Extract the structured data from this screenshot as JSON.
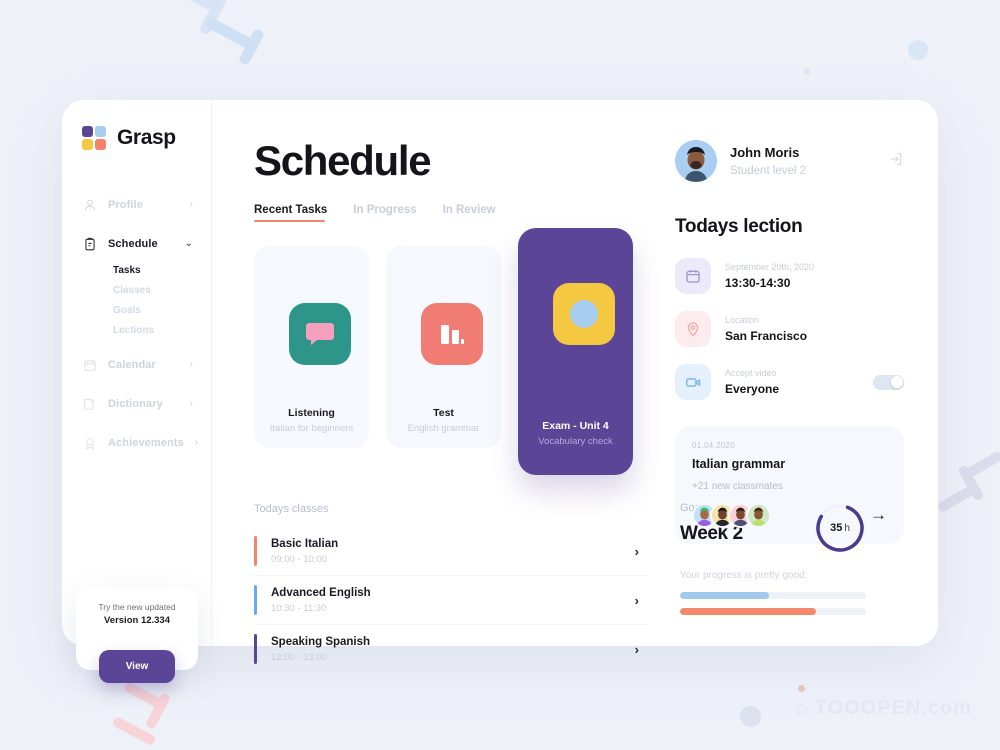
{
  "brand": {
    "name": "Grasp",
    "logo_icon": "puzzle-logo-icon",
    "colors": {
      "purple": "#5b4596",
      "blue": "#a7cdf0",
      "yellow": "#f5c842",
      "coral": "#f4836c"
    }
  },
  "sidebar": {
    "items": [
      {
        "label": "Profile",
        "icon": "person-icon",
        "chevron": "›",
        "active": false
      },
      {
        "label": "Schedule",
        "icon": "clipboard-icon",
        "chevron": "⌄",
        "active": true
      },
      {
        "label": "Calendar",
        "icon": "calendar-icon",
        "chevron": "›",
        "active": false
      },
      {
        "label": "Dictionary",
        "icon": "dictionary-icon",
        "chevron": "›",
        "active": false
      },
      {
        "label": "Achievements",
        "icon": "medal-icon",
        "chevron": "›",
        "active": false
      }
    ],
    "sub_items": [
      {
        "label": "Tasks",
        "active": true
      },
      {
        "label": "Classes",
        "active": false
      },
      {
        "label": "Goals",
        "active": false
      },
      {
        "label": "Lections",
        "active": false
      }
    ],
    "promo": {
      "line1": "Try the new updated",
      "line2": "Version 12.334",
      "button": "View"
    }
  },
  "header": {
    "title": "Schedule"
  },
  "tabs": [
    {
      "label": "Recent Tasks",
      "active": true
    },
    {
      "label": "In Progress",
      "active": false
    },
    {
      "label": "In Review",
      "active": false
    }
  ],
  "task_cards": [
    {
      "title": "Listening",
      "subtitle": "Italian for beginners",
      "icon": "chat-bubble-icon",
      "tile_color": "#2e9688",
      "accent_color": "#f6a0bd",
      "featured": false
    },
    {
      "title": "Test",
      "subtitle": "English grammar",
      "icon": "bar-chart-icon",
      "tile_color": "#f07c74",
      "accent_color": "#ffffff",
      "featured": false
    },
    {
      "title": "Exam - Unit 4",
      "subtitle": "Vocabulary check",
      "icon": "circle-shape-icon",
      "tile_color": "#f5c842",
      "accent_color": "#a7cdf0",
      "featured": true
    }
  ],
  "classes": {
    "label": "Todays classes",
    "items": [
      {
        "name": "Basic Italian",
        "time": "09:00 - 10:00",
        "color": "#f4836c",
        "arrow": "›"
      },
      {
        "name": "Advanced  English",
        "time": "10:30 - 11:30",
        "color": "#6aaceb",
        "arrow": "›"
      },
      {
        "name": "Speaking Spanish",
        "time": "12:00 - 13:00",
        "color": "#5b4596",
        "arrow": "›"
      }
    ]
  },
  "goals": {
    "label": "Goals",
    "week": "Week 2",
    "hours_value": "35",
    "hours_unit": "h",
    "note": "Your progress is pretty good:",
    "ring_percent": 78,
    "bars": [
      {
        "name": "blue-progress",
        "percent": 48,
        "color": "#a2c9ec"
      },
      {
        "name": "orange-progress",
        "percent": 73,
        "color": "#f4886a"
      }
    ]
  },
  "profile": {
    "name": "John Moris",
    "role": "Student level 2",
    "logout_icon": "logout-icon",
    "avatar_icon": "user-avatar"
  },
  "lection": {
    "title": "Todays lection",
    "rows": [
      {
        "label": "September 20th, 2020",
        "value": "13:30-14:30",
        "icon": "calendar-icon",
        "tile_bg": "#eceaf9",
        "icon_color": "#9a93d6",
        "toggle": null
      },
      {
        "label": "Location",
        "value": "San Francisco",
        "icon": "location-pin-icon",
        "tile_bg": "#fdeced",
        "icon_color": "#f3a8ac",
        "toggle": null
      },
      {
        "label": "Accept video",
        "value": "Everyone",
        "icon": "video-camera-icon",
        "tile_bg": "#e4f0fc",
        "icon_color": "#79b3e8",
        "toggle": "on"
      }
    ]
  },
  "upcoming": {
    "date": "01.04.2020",
    "title": "Italian grammar",
    "meta": "+21  new classmates",
    "arrow": "→",
    "avatar_colors": [
      "#bfe3f5",
      "#f7e2a8",
      "#f9d3d8",
      "#cfe9c4"
    ]
  },
  "watermark": "TOOOPEN.com"
}
